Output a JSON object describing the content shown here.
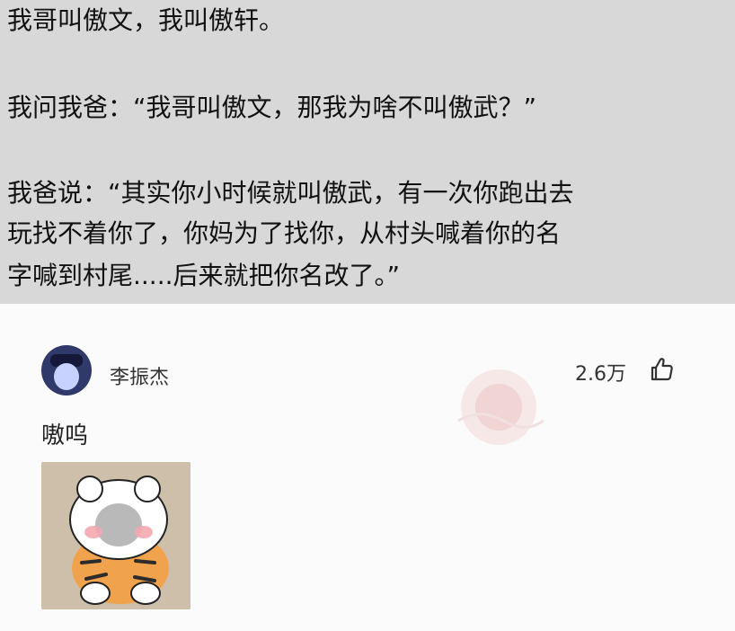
{
  "post": {
    "lines": [
      "我哥叫傲文，我叫傲轩。",
      "我问我爸：“我哥叫傲文，那我为啥不叫傲武？”",
      "我爸说：“其实你小时候就叫傲武，有一次你跑出去",
      "玩找不着你了，你妈为了找你，从村头喊着你的名",
      "字喊到村尾.....后来就把你名改了。”"
    ]
  },
  "comment": {
    "username": "李振杰",
    "likes": "2.6万",
    "text": "嗷呜",
    "icons": {
      "like": "thumbs-up-icon",
      "avatar": "user-avatar",
      "sticker": "tiger-meme-sticker"
    }
  }
}
